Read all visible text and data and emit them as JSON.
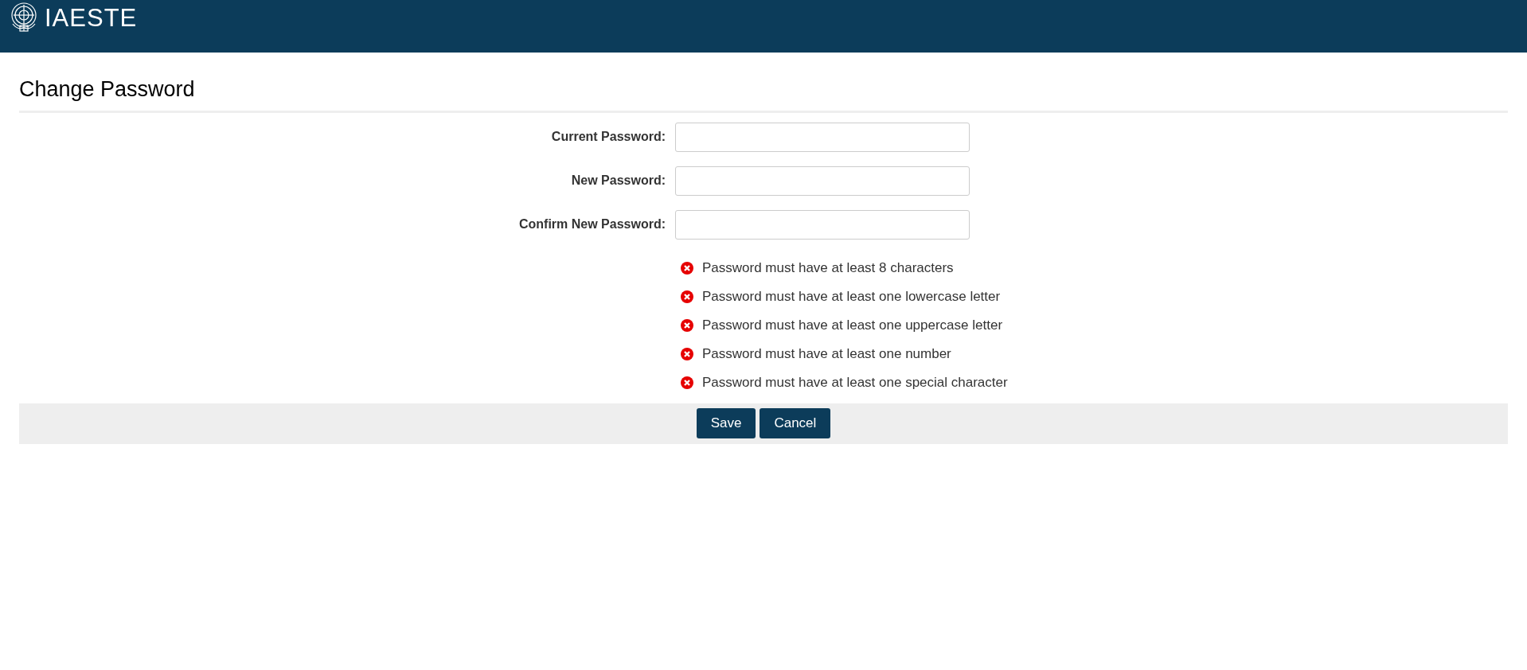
{
  "header": {
    "logo_text": "IAESTE"
  },
  "page": {
    "title": "Change Password"
  },
  "fields": [
    {
      "label": "Current Password:"
    },
    {
      "label": "New Password:"
    },
    {
      "label": "Confirm New Password:"
    }
  ],
  "requirements": [
    {
      "text": "Password must have at least 8 characters",
      "met": false
    },
    {
      "text": "Password must have at least one lowercase letter",
      "met": false
    },
    {
      "text": "Password must have at least one uppercase letter",
      "met": false
    },
    {
      "text": "Password must have at least one number",
      "met": false
    },
    {
      "text": "Password must have at least one special character",
      "met": false
    }
  ],
  "buttons": [
    "Save",
    "Cancel"
  ]
}
